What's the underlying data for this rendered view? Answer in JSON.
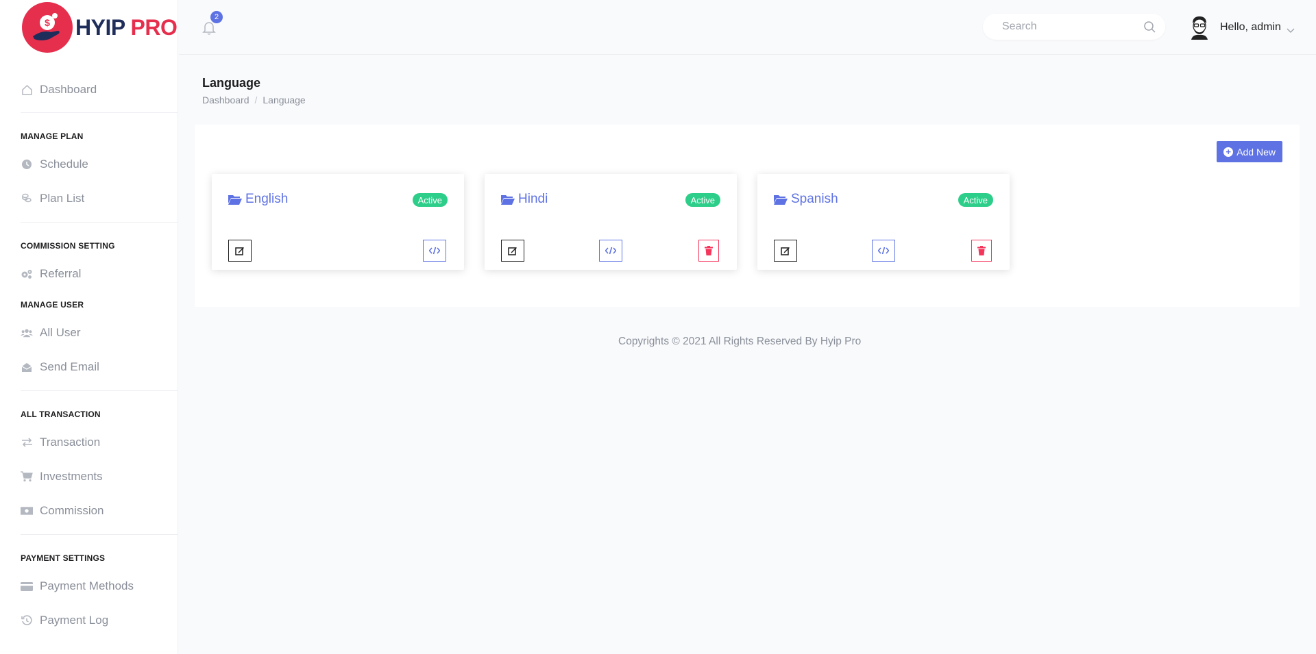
{
  "brand": {
    "name_part1": "HYIP",
    "name_part2": "PRO"
  },
  "sidebar": {
    "dashboard": "Dashboard",
    "sections": [
      {
        "heading": "MANAGE PLAN",
        "items": [
          "Schedule",
          "Plan List"
        ]
      },
      {
        "heading": "COMMISSION SETTING",
        "items": [
          "Referral"
        ]
      },
      {
        "heading": "MANAGE USER",
        "items": [
          "All User",
          "Send Email"
        ]
      },
      {
        "heading": "ALL TRANSACTION",
        "items": [
          "Transaction",
          "Investments",
          "Commission"
        ]
      },
      {
        "heading": "PAYMENT SETTINGS",
        "items": [
          "Payment Methods",
          "Payment Log"
        ]
      }
    ]
  },
  "header": {
    "notification_count": "2",
    "search_placeholder": "Search",
    "greeting": "Hello, admin"
  },
  "page": {
    "title": "Language",
    "breadcrumb": [
      "Dashboard",
      "Language"
    ],
    "add_button": "Add New"
  },
  "languages": [
    {
      "name": "English",
      "status": "Active"
    },
    {
      "name": "Hindi",
      "status": "Active"
    },
    {
      "name": "Spanish",
      "status": "Active"
    }
  ],
  "footer": "Copyrights © 2021 All Rights Reserved By Hyip Pro",
  "colors": {
    "primary": "#5e72e4",
    "success": "#2dce89",
    "danger": "#f5365c",
    "brand_red": "#e62e4d"
  }
}
